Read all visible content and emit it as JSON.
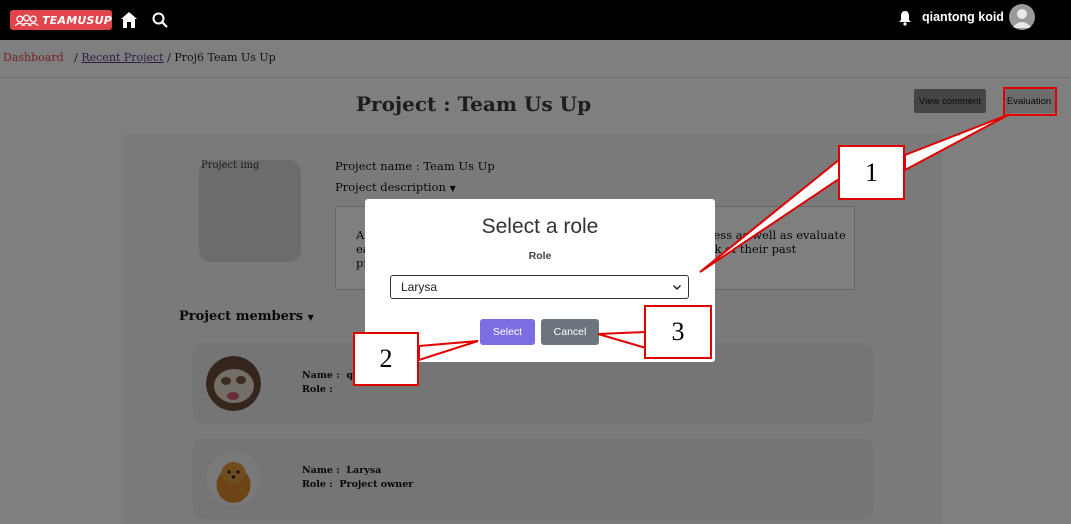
{
  "nav": {
    "logo_text": "TEAMUSUP",
    "username": "qiantong koid"
  },
  "breadcrumb": {
    "dashboard": "Dashboard",
    "sep1": "/",
    "recent_project": "Recent Project",
    "sep2": "/",
    "current": "Proj6 Team Us Up"
  },
  "project": {
    "title": "Project : Team Us Up",
    "view_comment_label": "View comment",
    "evaluation_label": "Evaluation",
    "image_alt": "Project img",
    "name_line": "Project name : Team Us Up",
    "description_label": "Project description",
    "description_fragment_left": "A ea pr",
    "description_fragment_right": "ress as well as evaluate ck of their past"
  },
  "members": {
    "heading": "Project members",
    "list": [
      {
        "name_label": "Name :",
        "name_value": "qi",
        "role_label": "Role :",
        "role_value": ""
      },
      {
        "name_label": "Name :",
        "name_value": "Larysa",
        "role_label": "Role :",
        "role_value": "Project owner"
      }
    ]
  },
  "modal": {
    "title": "Select a role",
    "role_label": "Role",
    "selected_role": "Larysa",
    "select_label": "Select",
    "cancel_label": "Cancel"
  },
  "callouts": {
    "one": "1",
    "two": "2",
    "three": "3"
  },
  "colors": {
    "brand_red": "#e0454b",
    "select_purple": "#7b6ee3",
    "cancel_gray": "#6c757d",
    "annotation_red": "#e00000"
  },
  "icons": [
    "logo-icon",
    "home-icon",
    "search-icon",
    "bell-icon",
    "user-avatar-icon",
    "caret-down-icon",
    "chevron-down-icon"
  ]
}
